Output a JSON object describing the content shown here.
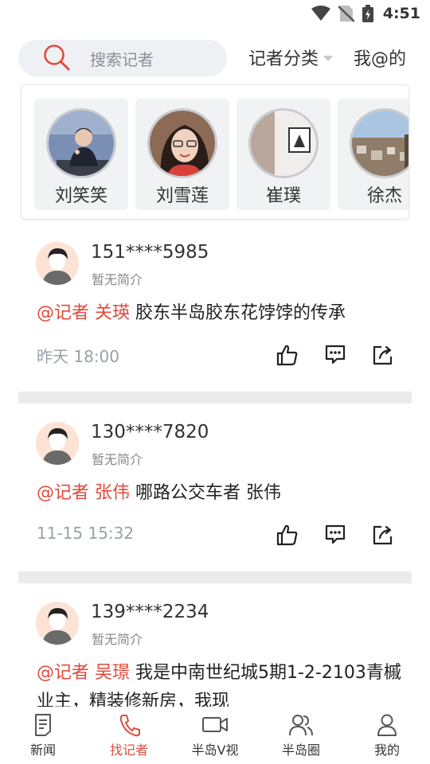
{
  "status": {
    "time": "4:51"
  },
  "search": {
    "placeholder": "搜索记者"
  },
  "header": {
    "category_label": "记者分类",
    "my_at_label": "我@的"
  },
  "reporters": [
    {
      "name": "刘笑笑"
    },
    {
      "name": "刘雪莲"
    },
    {
      "name": "崔璞"
    },
    {
      "name": "徐杰"
    }
  ],
  "posts": [
    {
      "user": "151****5985",
      "bio": "暂无简介",
      "mention": "@记者 关瑛",
      "text": " 胶东半岛胶东花饽饽的传承",
      "time": "昨天 18:00"
    },
    {
      "user": "130****7820",
      "bio": "暂无简介",
      "mention": "@记者 张伟",
      "text": " 哪路公交车者 张伟",
      "time": "11-15 15:32"
    },
    {
      "user": "139****2234",
      "bio": "暂无简介",
      "mention": "@记者 吴璟",
      "text": " 我是中南世纪城5期1-2-2103青槭业主，精装修新房，我现",
      "time": ""
    }
  ],
  "tabs": [
    {
      "label": "新闻",
      "icon": "news-icon"
    },
    {
      "label": "找记者",
      "icon": "phone-icon"
    },
    {
      "label": "半岛V视",
      "icon": "video-icon"
    },
    {
      "label": "半岛圈",
      "icon": "group-icon"
    },
    {
      "label": "我的",
      "icon": "person-icon"
    }
  ],
  "colors": {
    "accent": "#e04a3c",
    "divider": "#ebebeb",
    "search_bg": "#eef0f3"
  }
}
